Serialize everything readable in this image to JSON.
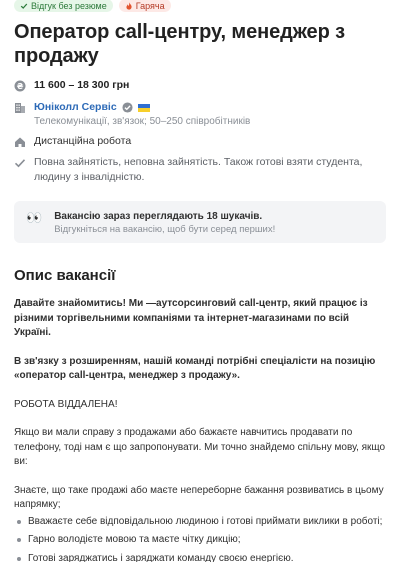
{
  "tags": {
    "no_resume": "Відгук без резюме",
    "hot": "Гаряча"
  },
  "title": "Оператор call-центру, менеджер з продажу",
  "salary": "11 600 – 18 300 грн",
  "company": {
    "name": "Юніколл Сервіс",
    "details": "Телекомунікації, зв'язок; 50–250 співробітників"
  },
  "work_format": "Дистанційна робота",
  "employment": "Повна зайнятість, неповна зайнятість. Також готові взяти студента, людину з інвалідністю.",
  "views": {
    "main": "Вакансію зараз переглядають 18 шукачів.",
    "sub": "Відгукніться на вакансію, щоб бути серед перших!"
  },
  "description": {
    "section_title": "Опис вакансії",
    "intro": "Давайте знайомитись! Ми —аутсорсинговий call-центр, який працює із різними торгівельними компаніями та інтернет-магазинами по всій Україні.",
    "expansion": "В зв'язку з розширенням, нашій команді потрібні спеціалісти на позицію «оператор call-центра, менеджер з продажу».",
    "remote": "РОБОТА ВІДДАЛЕНА!",
    "offer": "Якщо ви мали справу з продажами або бажаєте навчитись продавати по телефону, тоді нам є що запропонувати. Ми точно знайдемо спільну мову, якщо ви:",
    "know": "Знаєте, що таке продажі або маєте непереборне бажання розвиватись в цьому напрямку;",
    "bullets": [
      "Вважаєте себе відповідальною людиною і готові приймати виклики в роботі;",
      "Гарно володієте мовою та маєте чітку дикцію;",
      "Готові заряджатись і заряджати команду своєю енергією."
    ]
  },
  "colors": {
    "link": "#2d6ab7",
    "green_tag_bg": "#e6f6e8",
    "hot_tag_bg": "#fde9e6",
    "box_bg": "#f3f4f6"
  }
}
